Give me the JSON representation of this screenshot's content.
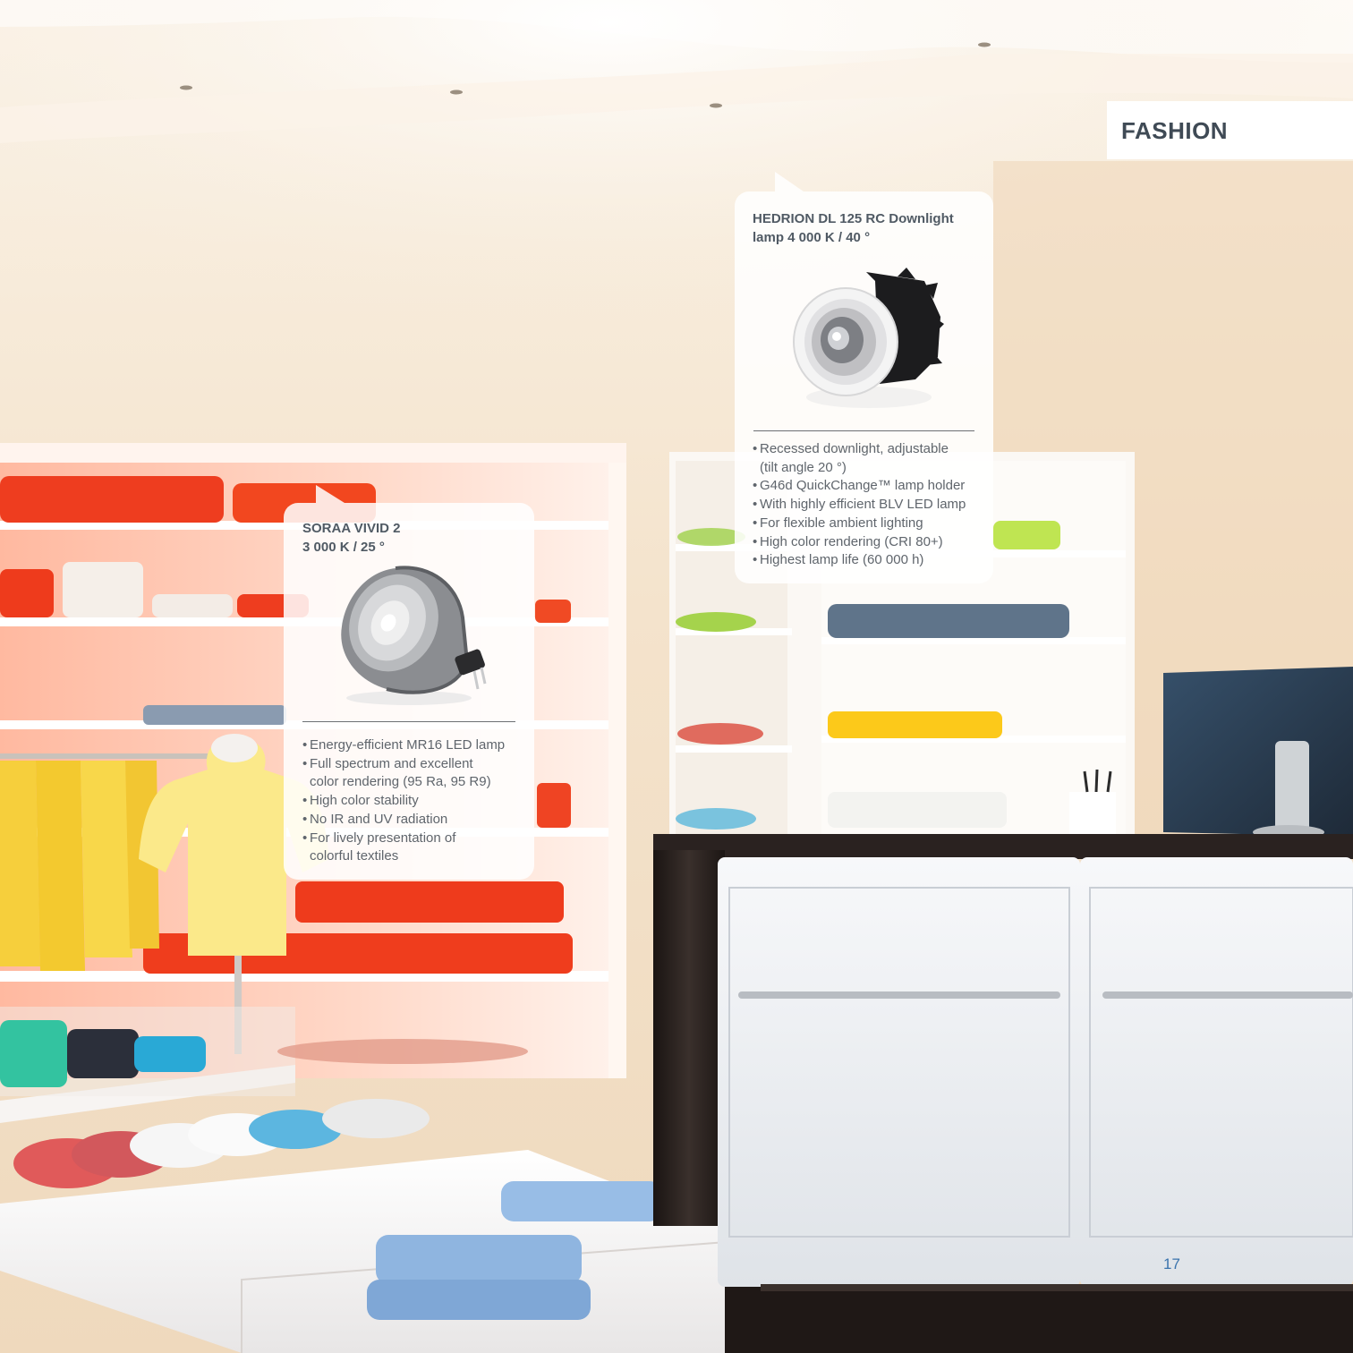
{
  "section": {
    "title": "FASHION"
  },
  "callouts": [
    {
      "title_line1": "HEDRION DL 125 RC Downlight",
      "title_line2": "lamp 4 000 K / 40 °",
      "product_image": "recessed-downlight-lamp",
      "features": [
        "Recessed downlight, adjustable",
        "(tilt angle 20 °)",
        "G46d QuickChange™ lamp holder",
        "With highly efficient BLV LED lamp",
        "For flexible ambient lighting",
        "High color rendering (CRI 80+)",
        "Highest lamp life (60 000 h)"
      ]
    },
    {
      "title_line1": "SORAA VIVID 2",
      "title_line2": "3 000 K / 25 °",
      "product_image": "mr16-led-lamp",
      "features": [
        "Energy-efficient MR16 LED lamp",
        "Full spectrum and excellent",
        "color rendering (95 Ra, 95 R9)",
        "High color stability",
        "No IR and UV radiation",
        "For lively presentation of",
        "colorful textiles"
      ]
    }
  ],
  "page_number": "17",
  "colors": {
    "wall": "#f3e6d4",
    "shelf_glow": "#ff8a6a",
    "counter_dark": "#2a2220",
    "cabinet": "#eceef2",
    "heading_text": "#3f4a55",
    "page_number": "#3a73ad"
  }
}
